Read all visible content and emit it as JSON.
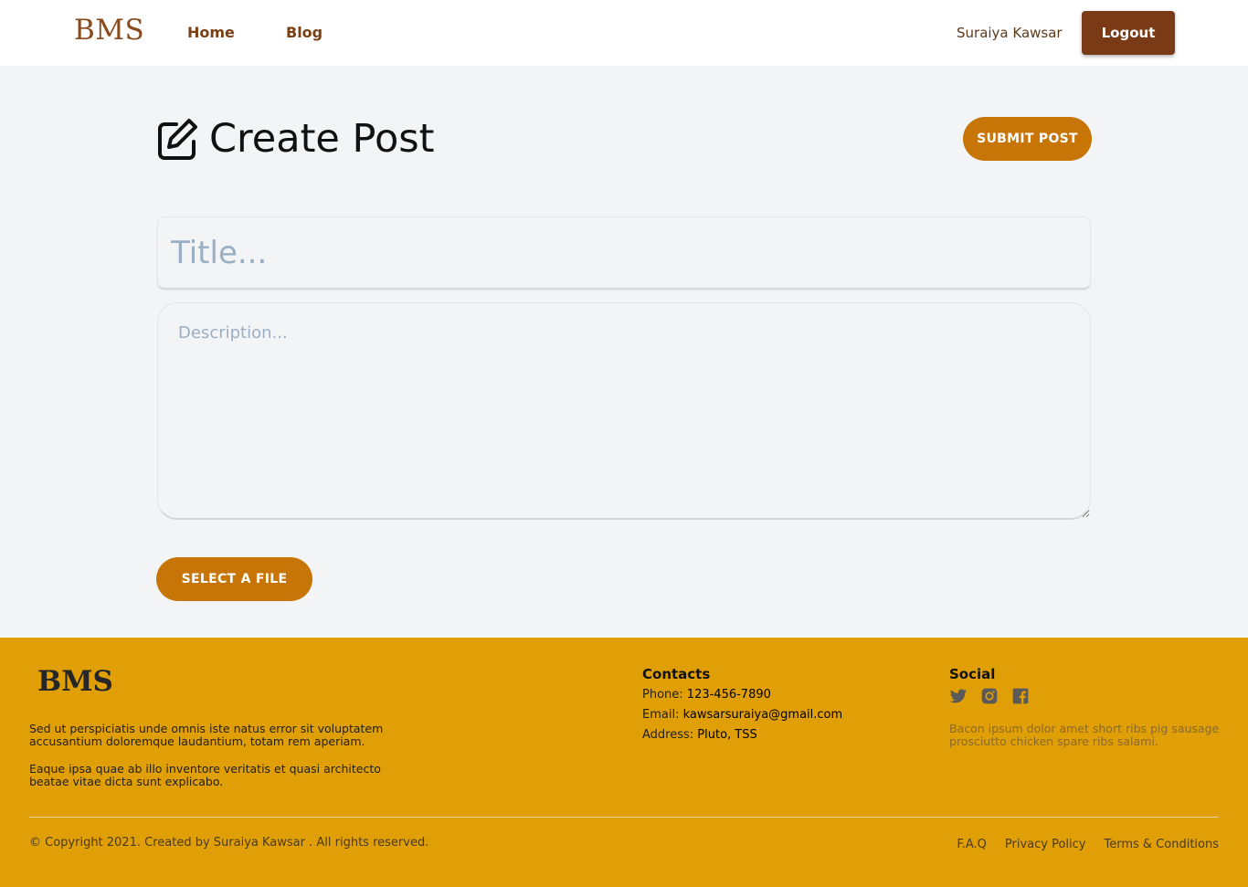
{
  "header": {
    "logo": "BMS",
    "nav": [
      {
        "label": "Home"
      },
      {
        "label": "Blog"
      }
    ],
    "user_name": "Suraiya Kawsar",
    "logout_label": "Logout"
  },
  "main": {
    "page_title": "Create Post",
    "submit_label": "SUBMIT POST",
    "title_placeholder": "Title...",
    "description_placeholder": "Description...",
    "file_button_label": "SELECT A FILE"
  },
  "footer": {
    "logo": "BMS",
    "text1": "Sed ut perspiciatis unde omnis iste natus error sit voluptatem accusantium doloremque laudantium, totam rem aperiam.",
    "text2": "Eaque ipsa quae ab illo inventore veritatis et quasi architecto beatae vitae dicta sunt explicabo.",
    "contacts_title": "Contacts",
    "phone_label": "Phone:",
    "phone": "123-456-7890",
    "email_label": "Email:",
    "email": "kawsarsuraiya@gmail.com",
    "address_label": "Address:",
    "address": "Pluto, TSS",
    "social_title": "Social",
    "social_icons": [
      "twitter-icon",
      "instagram-icon",
      "facebook-icon"
    ],
    "social_text": "Bacon ipsum dolor amet short ribs pig sausage prosciutto chicken spare ribs salami.",
    "copyright": "© Copyright 2021. Created by Suraiya Kawsar . All rights reserved.",
    "links": [
      {
        "label": "F.A.Q"
      },
      {
        "label": "Privacy Policy"
      },
      {
        "label": "Terms & Conditions"
      }
    ]
  },
  "colors": {
    "brand_brown": "#7a3a16",
    "accent_orange": "#c77506",
    "footer_bg": "#e09f07",
    "page_bg": "#f3f4f6"
  }
}
